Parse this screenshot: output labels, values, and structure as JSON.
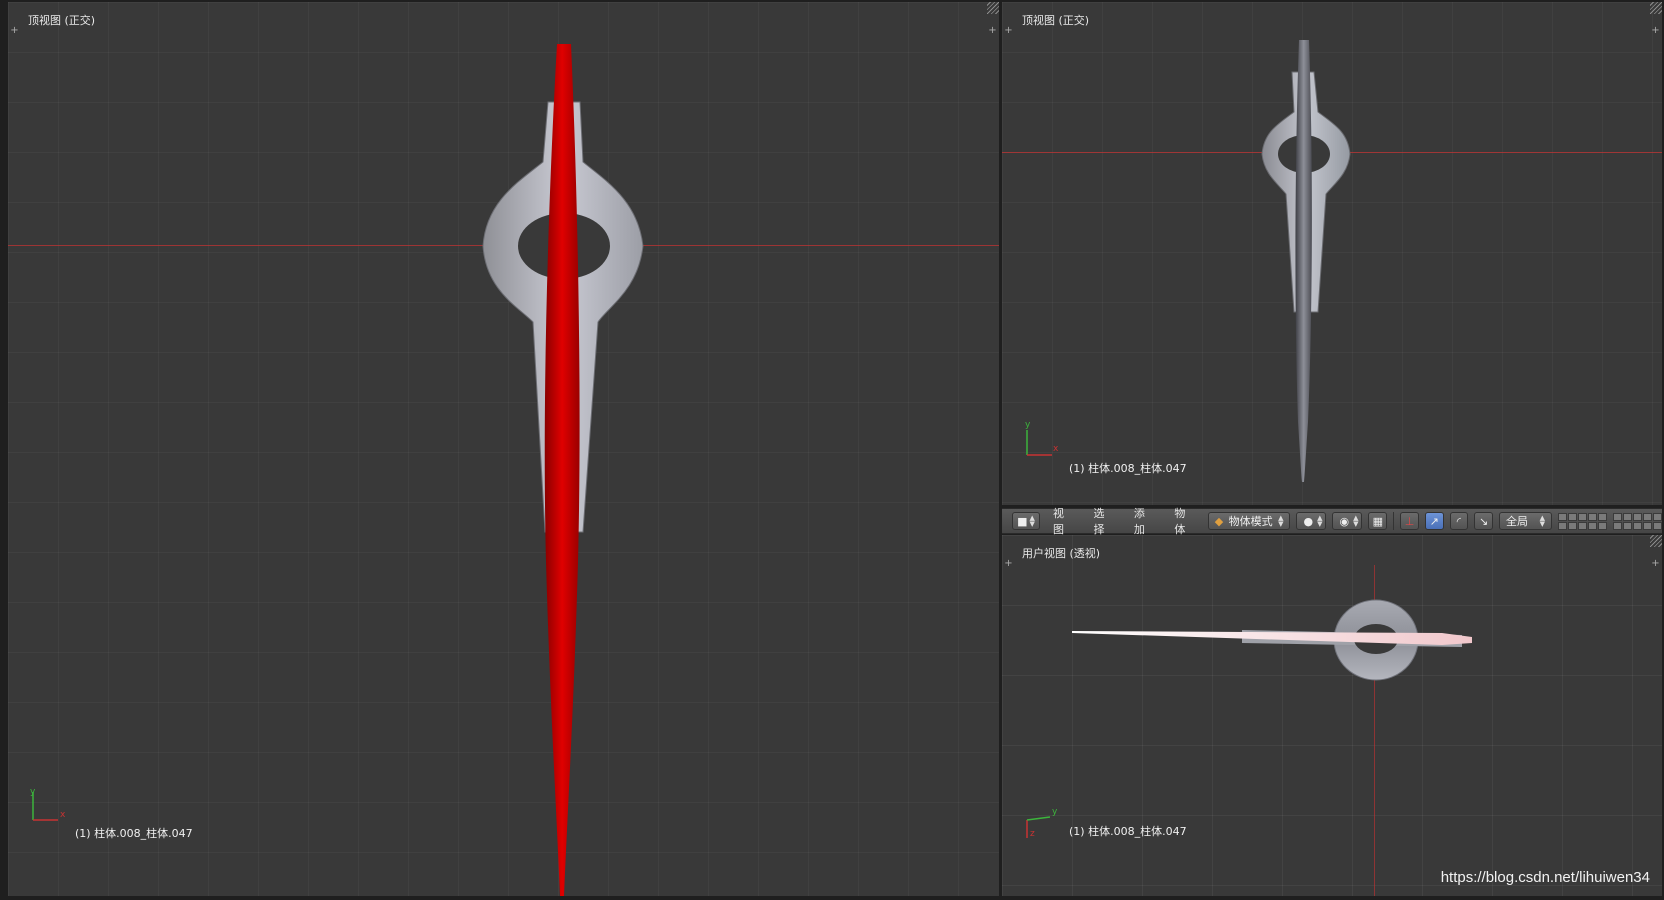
{
  "viewports": {
    "main": {
      "title": "顶视图 (正交)",
      "object_label": "(1) 柱体.008_柱体.047",
      "axis": {
        "y": "y",
        "x": "x"
      }
    },
    "top_right": {
      "title": "顶视图 (正交)",
      "object_label": "(1) 柱体.008_柱体.047",
      "axis": {
        "y": "y",
        "x": "x"
      }
    },
    "bottom_right": {
      "title": "用户视图 (透视)",
      "object_label": "(1) 柱体.008_柱体.047",
      "axis": {
        "y": "y",
        "z": "z"
      }
    }
  },
  "toolbar": {
    "view": "视图",
    "select": "选择",
    "add": "添加",
    "object": "物体",
    "mode": "物体模式",
    "pivot": "全局"
  },
  "colors": {
    "viewport_bg": "#393939",
    "selected_red": "#cc0000",
    "x_axis": "#c83232",
    "y_axis": "#3cb43c",
    "manipulator_blue": "#5a7fc8"
  },
  "watermark": "https://blog.csdn.net/lihuiwen34"
}
